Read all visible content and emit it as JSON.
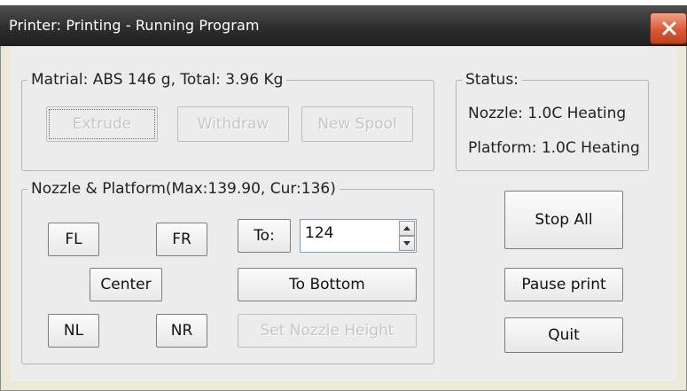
{
  "window": {
    "title": "Printer: Printing - Running Program"
  },
  "material": {
    "legend": "Matrial: ABS 146 g,  Total: 3.96 Kg",
    "extrude_label": "Extrude",
    "withdraw_label": "Withdraw",
    "new_spool_label": "New Spool"
  },
  "status": {
    "legend": "Status:",
    "nozzle": "Nozzle: 1.0C Heating",
    "platform": "Platform: 1.0C Heating"
  },
  "nozzle_platform": {
    "legend": "Nozzle & Platform(Max:139.90, Cur:136)",
    "fl_label": "FL",
    "fr_label": "FR",
    "to_label": "To:",
    "to_value": "124",
    "center_label": "Center",
    "to_bottom_label": "To Bottom",
    "nl_label": "NL",
    "nr_label": "NR",
    "set_nozzle_height_label": "Set Nozzle Height"
  },
  "actions": {
    "stop_all_label": "Stop All",
    "pause_print_label": "Pause print",
    "quit_label": "Quit"
  },
  "icons": {
    "close": "close-icon",
    "spin_up": "spin-up-icon",
    "spin_down": "spin-down-icon"
  }
}
